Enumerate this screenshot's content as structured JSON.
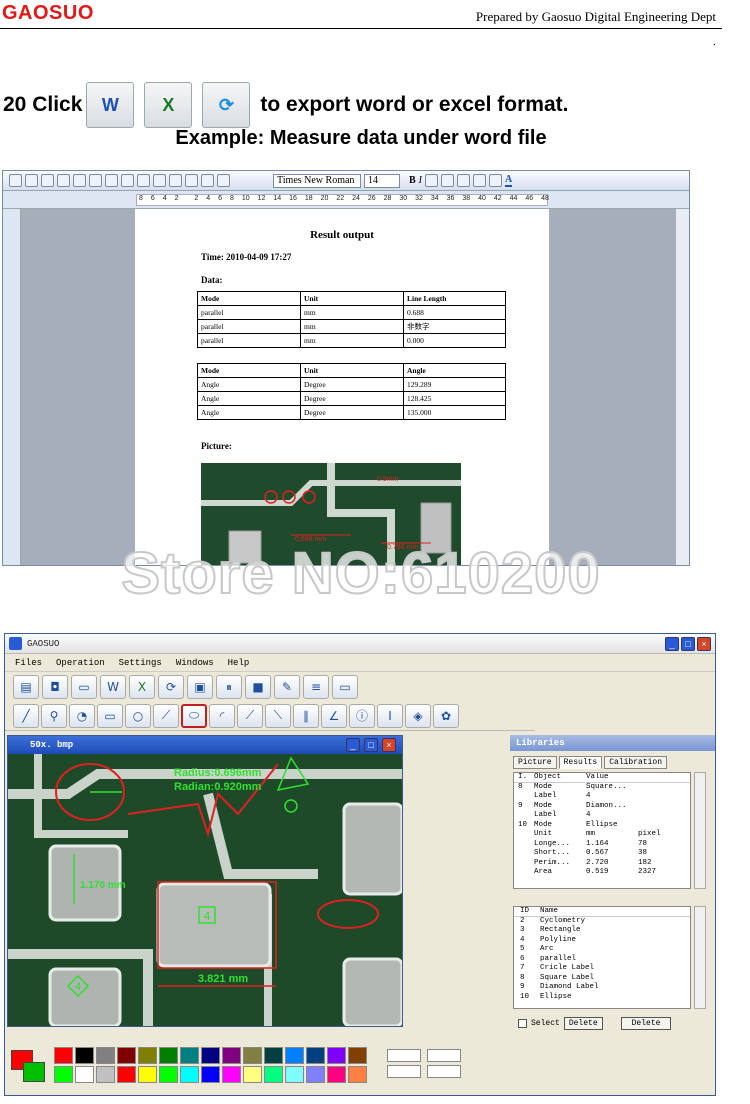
{
  "header": {
    "brand": "GAOSUO",
    "prepared_by": "Prepared by Gaosuo Digital Engineering Dept",
    "dot": "."
  },
  "step": {
    "prefix": "20 Click",
    "suffix": "to export word or excel format.",
    "icons": [
      "word-export-icon",
      "excel-export-icon",
      "refresh-export-icon"
    ]
  },
  "example_title": "Example: Measure data under word file",
  "word": {
    "font_name": "Times New Roman",
    "font_size": "14",
    "ruler_ticks": [
      "8",
      "6",
      "4",
      "2",
      "",
      "2",
      "4",
      "6",
      "8",
      "10",
      "12",
      "14",
      "16",
      "18",
      "20",
      "22",
      "24",
      "26",
      "28",
      "30",
      "32",
      "34",
      "36",
      "38",
      "40",
      "42",
      "44",
      "46",
      "48"
    ],
    "doc": {
      "title": "Result output",
      "time": "Time: 2010-04-09    17:27",
      "data_label": "Data:",
      "table1": {
        "headers": [
          "Mode",
          "Unit",
          "Line Length"
        ],
        "rows": [
          [
            "parallel",
            "mm",
            "0.688"
          ],
          [
            "parallel",
            "mm",
            "非数字"
          ],
          [
            "parallel",
            "mm",
            "0.000"
          ]
        ]
      },
      "table2": {
        "headers": [
          "Mode",
          "Unit",
          "Angle"
        ],
        "rows": [
          [
            "Angle",
            "Degree",
            "129.289"
          ],
          [
            "Angle",
            "Degree",
            "128.425"
          ],
          [
            "Angle",
            "Degree",
            "135.000"
          ]
        ]
      },
      "picture_label": "Picture:",
      "pic_labels": {
        "a": "0.9mm",
        "b": "0.688 mm",
        "c": "0.780 mm"
      }
    }
  },
  "watermark": "Store  NO:610200",
  "app": {
    "title": "GAOSUO",
    "menu": [
      "Files",
      "Operation",
      "Settings",
      "Windows",
      "Help"
    ],
    "sub_title": "50x. bmp",
    "image": {
      "radius": "Radius:0.696mm",
      "radian": "Radian:0.920mm",
      "length1": "1.170 mm",
      "length2": "3.821 mm",
      "box1": "4",
      "box2": "4"
    },
    "libraries": {
      "title": "Libraries",
      "tabs": [
        "Picture",
        "Results",
        "Calibration"
      ],
      "result_headers": [
        "I.",
        "Object",
        "Value",
        ""
      ],
      "results": [
        [
          "8",
          "Mode",
          "Square...",
          ""
        ],
        [
          "",
          "Label",
          "4",
          ""
        ],
        [
          "9",
          "Mode",
          "Diamon...",
          ""
        ],
        [
          "",
          "Label",
          "4",
          ""
        ],
        [
          "10",
          "Mode",
          "Ellipse",
          ""
        ],
        [
          "",
          "Unit",
          "mm",
          "pixel"
        ],
        [
          "",
          "Longe...",
          "1.164",
          "78"
        ],
        [
          "",
          "Short...",
          "0.567",
          "38"
        ],
        [
          "",
          "Perim...",
          "2.720",
          "182"
        ],
        [
          "",
          "Area",
          "0.519",
          "2327"
        ]
      ],
      "name_headers": [
        "ID",
        "Name"
      ],
      "names": [
        [
          "2",
          "Cyclometry"
        ],
        [
          "3",
          "Rectangle"
        ],
        [
          "4",
          "Polyline"
        ],
        [
          "5",
          "Arc"
        ],
        [
          "6",
          "parallel"
        ],
        [
          "7",
          "Cricle Label"
        ],
        [
          "8",
          "Square Label"
        ],
        [
          "9",
          "Diamond Label"
        ],
        [
          "10",
          "Ellipse"
        ]
      ],
      "select_label": "Select",
      "delete1": "Delete",
      "delete2": "Delete"
    },
    "palette": {
      "row1": [
        "#ff0000",
        "#000000",
        "#808080",
        "#800000",
        "#808000",
        "#008000",
        "#008080",
        "#000080",
        "#800080",
        "#808040",
        "#004040",
        "#0080ff",
        "#004080",
        "#8000ff",
        "#804000"
      ],
      "row2": [
        "#00ff00",
        "#ffffff",
        "#c0c0c0",
        "#ff0000",
        "#ffff00",
        "#00ff00",
        "#00ffff",
        "#0000ff",
        "#ff00ff",
        "#ffff80",
        "#00ff80",
        "#80ffff",
        "#8080ff",
        "#ff0080",
        "#ff8040"
      ]
    }
  }
}
